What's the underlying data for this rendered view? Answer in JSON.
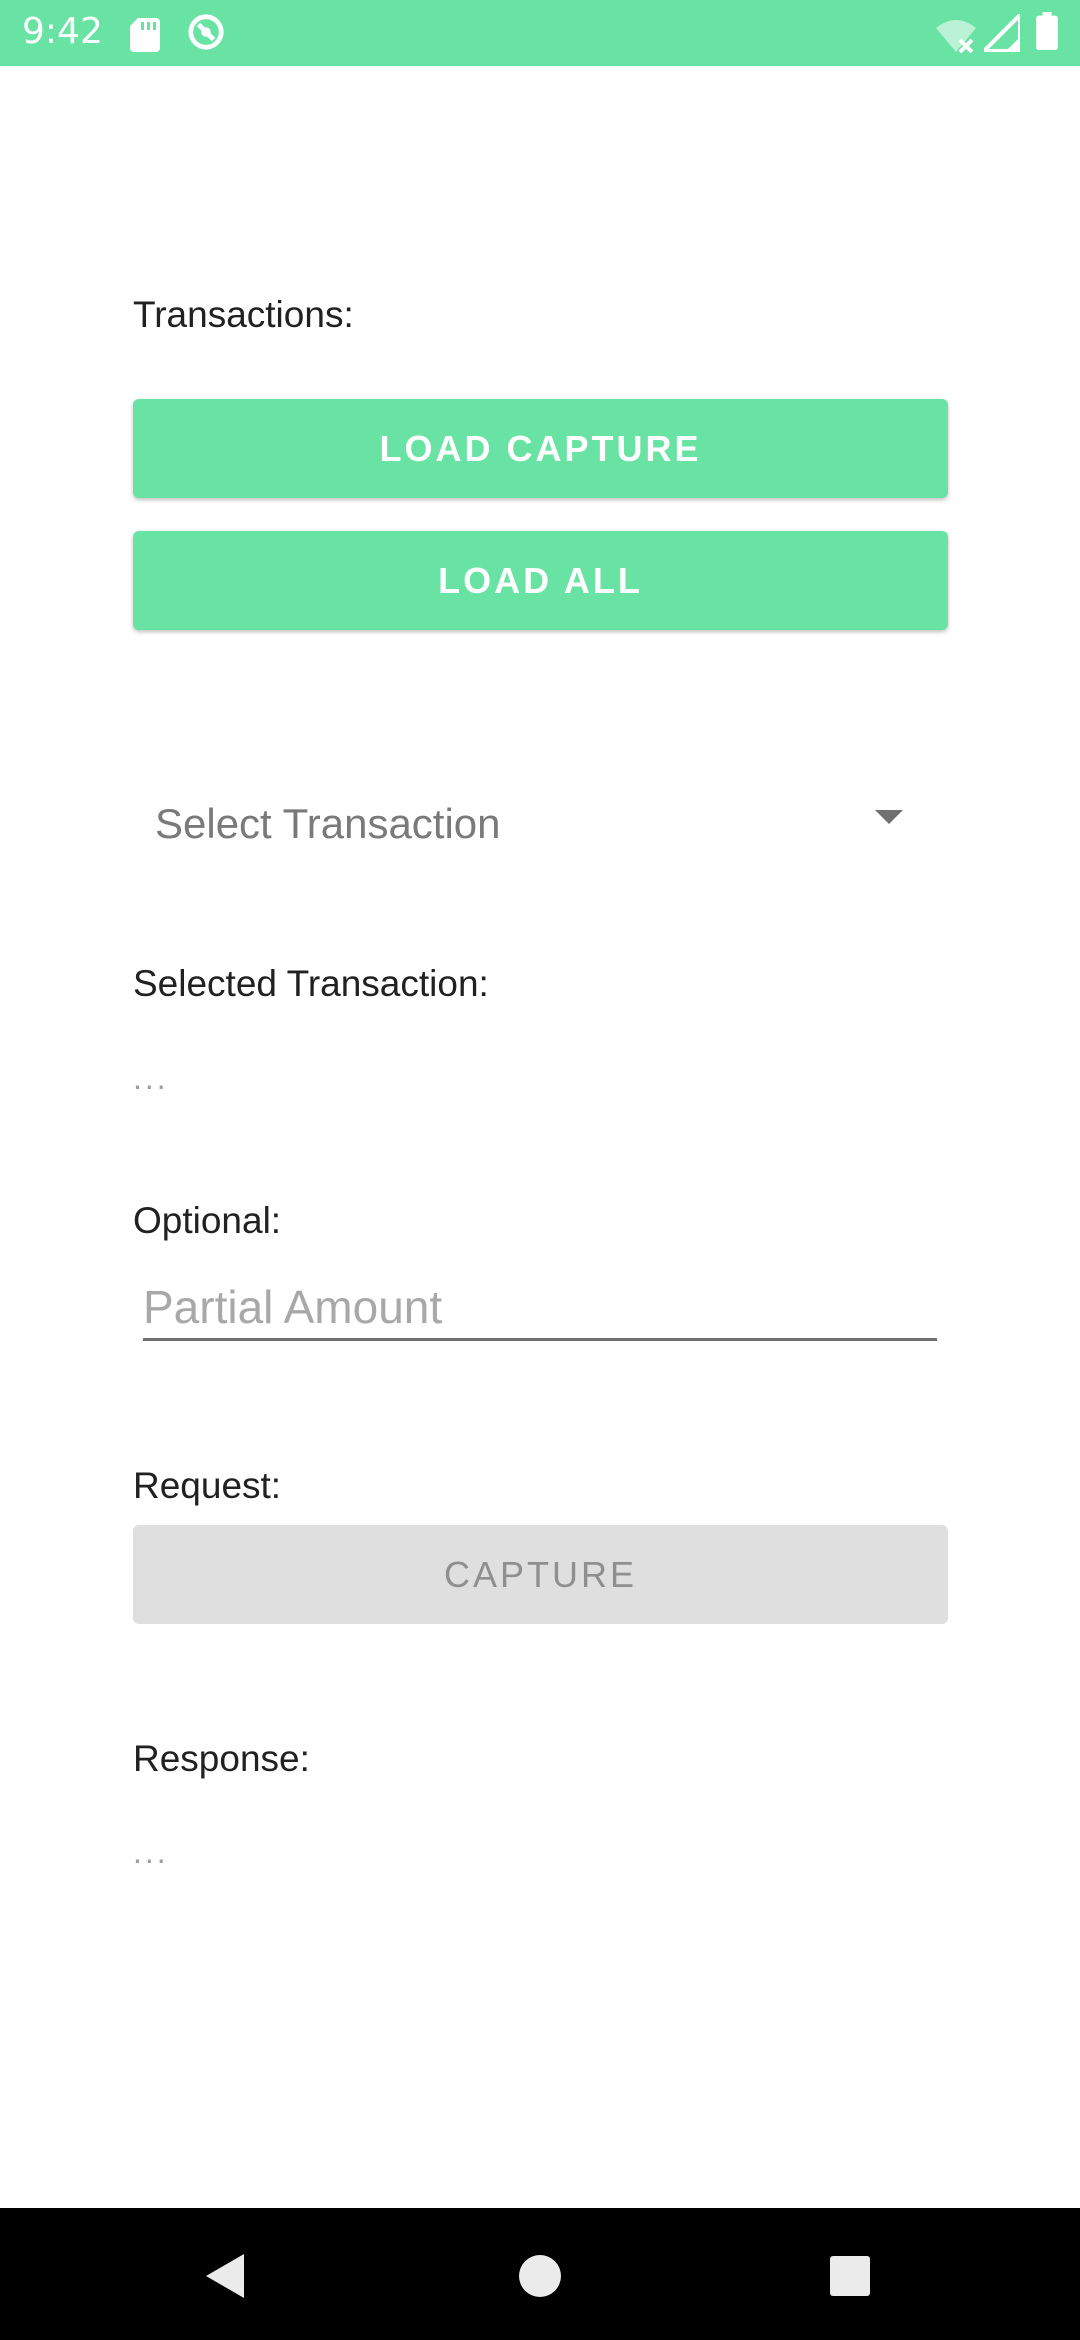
{
  "status_bar": {
    "time": "9:42",
    "background": "#69E3A3",
    "icons": [
      "sd-card-icon",
      "sync-icon",
      "wifi-off-icon",
      "signal-icon",
      "battery-icon"
    ]
  },
  "screen": {
    "transactions_label": "Transactions:",
    "load_capture_label": "LOAD CAPTURE",
    "load_all_label": "LOAD ALL",
    "select_transaction_placeholder": "Select Transaction",
    "selected_transaction_label": "Selected Transaction:",
    "selected_transaction_value": "...",
    "optional_label": "Optional:",
    "partial_amount_placeholder": "Partial Amount",
    "request_label": "Request:",
    "capture_label": "CAPTURE",
    "response_label": "Response:",
    "response_value": "..."
  },
  "colors": {
    "accent": "#69E3A3",
    "disabled_button": "#DFDFDF"
  },
  "nav_bar": {
    "buttons": [
      "back-icon",
      "home-icon",
      "recents-icon"
    ]
  }
}
